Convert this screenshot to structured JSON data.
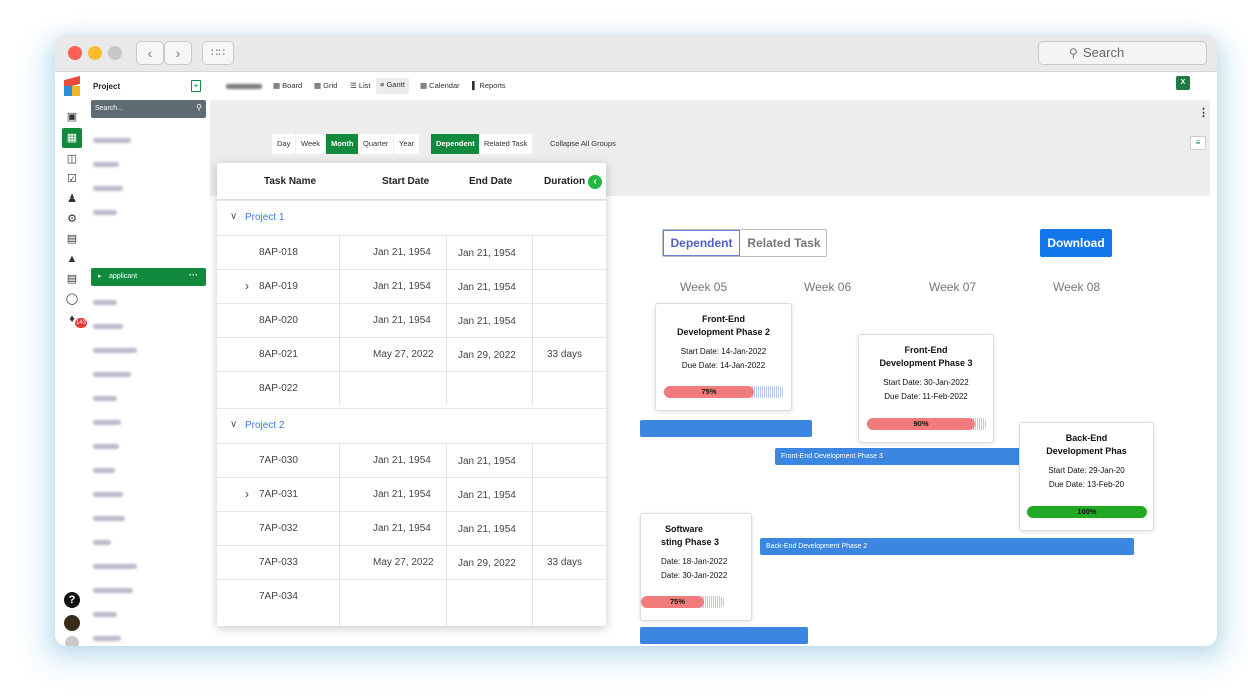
{
  "window": {
    "search_placeholder": "Search"
  },
  "sidebar": {
    "project_label": "Project",
    "search_placeholder": "Search...",
    "selected_project": "applicant",
    "notification_count": "143"
  },
  "view_tabs": {
    "board": "Board",
    "grid": "Grid",
    "list": "List",
    "gantt": "Gantt",
    "calendar": "Calendar",
    "reports": "Reports"
  },
  "scale": {
    "day": "Day",
    "week": "Week",
    "month": "Month",
    "quarter": "Quarter",
    "year": "Year"
  },
  "filters": {
    "dependent": "Dependent",
    "related": "Related Task",
    "collapse": "Collapse All Groups"
  },
  "gantt": {
    "dependent": "Dependent",
    "related": "Related Task",
    "download": "Download",
    "weeks": [
      "Week 05",
      "Week 06",
      "Week 07",
      "Week 08"
    ],
    "bars": {
      "fe3": "Front-End Development Phase 3",
      "be2": "Back-End Development Phase 2"
    },
    "cards": {
      "fe2": {
        "title1": "Front-End",
        "title2": "Development Phase 2",
        "start": "Start Date: 14-Jan-2022",
        "due": "Due Date: 14-Jan-2022",
        "progress": "75%",
        "progress_value": 0.75
      },
      "fe3": {
        "title1": "Front-End",
        "title2": "Development Phase 3",
        "start": "Start Date: 30-Jan-2022",
        "due": "Due Date: 11-Feb-2022",
        "progress": "90%",
        "progress_value": 0.9
      },
      "be": {
        "title1": "Back-End",
        "title2": "Development Phas",
        "start": "Start Date: 29-Jan-20",
        "due": "Due Date: 13-Feb-20",
        "progress": "100%",
        "progress_value": 1.0
      },
      "sw": {
        "title1": "Software",
        "title2": "sting Phase 3",
        "start": "Date: 18-Jan-2022",
        "due": "Date: 30-Jan-2022",
        "progress": "75%",
        "progress_value": 0.75
      }
    }
  },
  "table": {
    "headers": {
      "name": "Task Name",
      "start": "Start Date",
      "end": "End Date",
      "duration": "Duration"
    },
    "groups": [
      "Project 1",
      "Project 2"
    ],
    "rows": [
      {
        "name": "8AP-018",
        "start": "Jan 21, 1954",
        "end": "Jan 21, 1954",
        "duration": ""
      },
      {
        "name": "8AP-019",
        "start": "Jan 21, 1954",
        "end": "Jan 21, 1954",
        "duration": ""
      },
      {
        "name": "8AP-020",
        "start": "Jan 21, 1954",
        "end": "Jan 21, 1954",
        "duration": ""
      },
      {
        "name": "8AP-021",
        "start": "May 27, 2022",
        "end": "Jan 29, 2022",
        "duration": "33 days"
      },
      {
        "name": "8AP-022",
        "start": "",
        "end": "",
        "duration": ""
      },
      {
        "name": "7AP-030",
        "start": "Jan 21, 1954",
        "end": "Jan 21, 1954",
        "duration": ""
      },
      {
        "name": "7AP-031",
        "start": "Jan 21, 1954",
        "end": "Jan 21, 1954",
        "duration": ""
      },
      {
        "name": "7AP-032",
        "start": "Jan 21, 1954",
        "end": "Jan 21, 1954",
        "duration": ""
      },
      {
        "name": "7AP-033",
        "start": "May 27, 2022",
        "end": "Jan 29, 2022",
        "duration": "33 days"
      },
      {
        "name": "7AP-034",
        "start": "",
        "end": "",
        "duration": ""
      }
    ]
  },
  "colors": {
    "accent_green": "#118a3e",
    "bar_blue": "#3a86e0",
    "progress_red": "#f27b7b",
    "progress_green": "#22a822"
  }
}
